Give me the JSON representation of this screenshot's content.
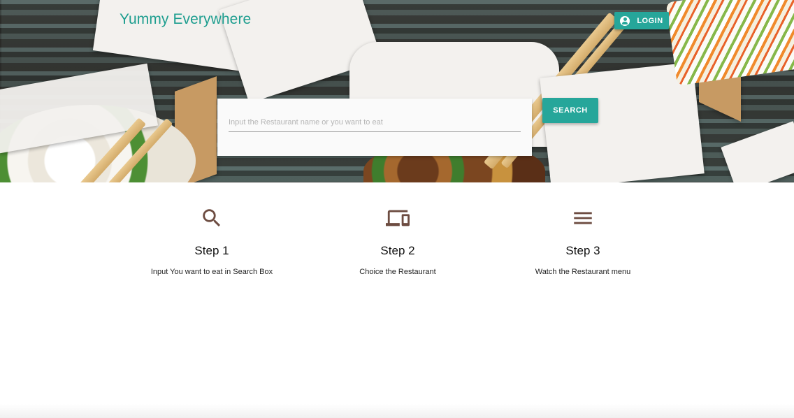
{
  "header": {
    "brand": "Yummy Everywhere",
    "login_label": "LOGIN",
    "login_icon": "account-circle-icon"
  },
  "search": {
    "placeholder": "Input the Restaurant name or you want to eat",
    "value": "",
    "button_label": "SEARCH"
  },
  "steps": [
    {
      "icon": "search-icon",
      "title": "Step 1",
      "description": "Input You want to eat in Search Box"
    },
    {
      "icon": "devices-icon",
      "title": "Step 2",
      "description": "Choice the Restaurant"
    },
    {
      "icon": "menu-icon",
      "title": "Step 3",
      "description": "Watch the Restaurant menu"
    }
  ],
  "colors": {
    "accent": "#26a69a",
    "brand_text": "#1e9e8f",
    "icon_brown": "#6d4c41"
  }
}
